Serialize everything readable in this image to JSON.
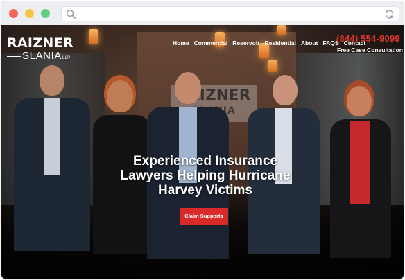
{
  "browser": {
    "url": "",
    "search_icon": "search-icon",
    "refresh_icon": "refresh-icon"
  },
  "logo": {
    "line1": "RAIZNER",
    "line2": "SLANIA",
    "suffix": "LLP"
  },
  "nav": {
    "items": [
      "Home",
      "Commercial",
      "Reservoir",
      "Residential",
      "About",
      "FAQS",
      "Contact"
    ]
  },
  "contact": {
    "phone": "(844) 554-9099",
    "consult": "Free Case Consultation"
  },
  "hero": {
    "headline": "Experienced Insurance Lawyers Helping Hurricane Harvey Victims",
    "cta": "Claim Supports",
    "sign_line1": "RAIZNER",
    "sign_line2": "SLANIA"
  },
  "colors": {
    "accent_red": "#e0362b",
    "cta_red": "#d92a2a",
    "traffic_red": "#f2665b",
    "traffic_yellow": "#f6c544",
    "traffic_green": "#5fcf7e"
  }
}
